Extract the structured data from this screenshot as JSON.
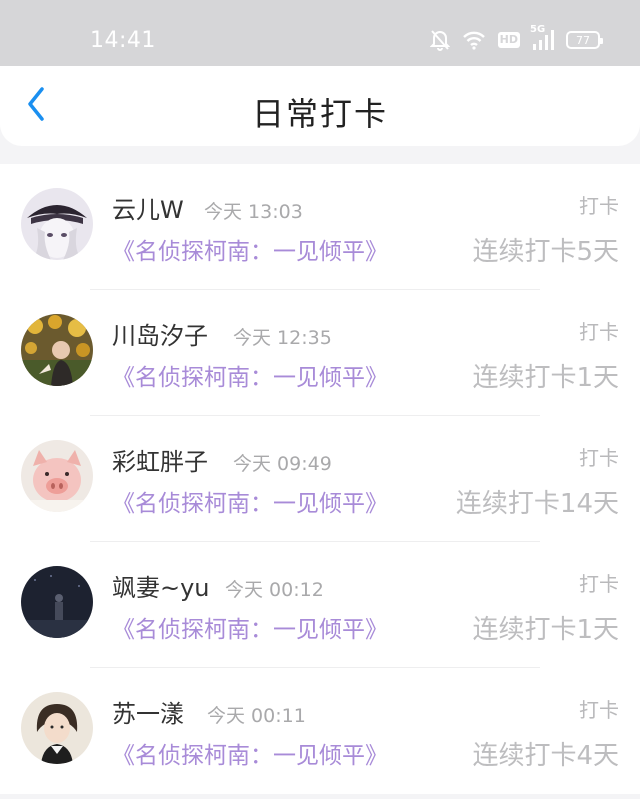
{
  "status_bar": {
    "time": "14:41",
    "battery": "77",
    "network": "5G",
    "hd": "HD",
    "icons": [
      "bell-off-icon",
      "wifi-icon",
      "hd-icon",
      "signal-icon",
      "battery-icon"
    ]
  },
  "nav": {
    "title": "日常打卡",
    "back_icon": "chevron-left-icon"
  },
  "colors": {
    "accent": "#1a8ff0",
    "book_link": "#a88bd8",
    "muted": "#a9a9ab"
  },
  "entries": [
    {
      "name": "云儿W",
      "time": "今天 13:03",
      "action": "打卡",
      "book": "《名侦探柯南：一见倾平》",
      "streak": "连续打卡5天",
      "avatar": "anime-avatar"
    },
    {
      "name": "川岛汐子",
      "time": "今天 12:35",
      "action": "打卡",
      "book": "《名侦探柯南：一见倾平》",
      "streak": "连续打卡1天",
      "avatar": "sunflower-photo-avatar"
    },
    {
      "name": "彩虹胖子",
      "time": "今天 09:49",
      "action": "打卡",
      "book": "《名侦探柯南：一见倾平》",
      "streak": "连续打卡14天",
      "avatar": "pig-avatar"
    },
    {
      "name": "飒妻~yu",
      "time": "今天 00:12",
      "action": "打卡",
      "book": "《名侦探柯南：一见倾平》",
      "streak": "连续打卡1天",
      "avatar": "night-figure-avatar"
    },
    {
      "name": "苏一漾",
      "time": "今天 00:11",
      "action": "打卡",
      "book": "《名侦探柯南：一见倾平》",
      "streak": "连续打卡4天",
      "avatar": "portrait-avatar"
    }
  ]
}
